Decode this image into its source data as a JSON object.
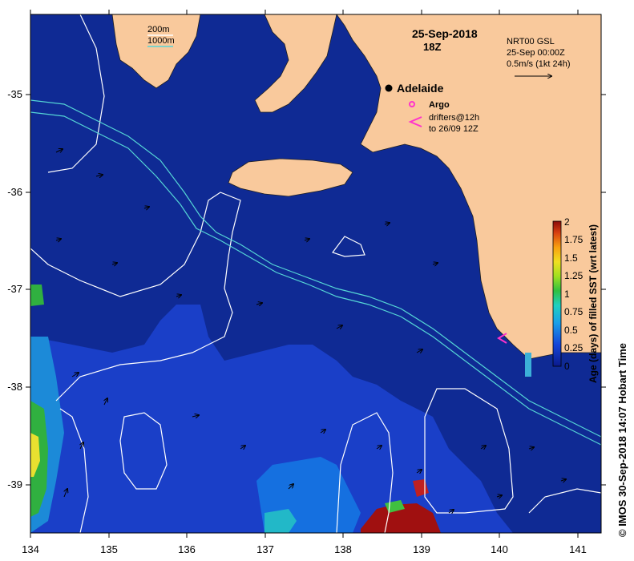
{
  "map": {
    "date_label": "25-Sep-2018",
    "time_label": "18Z",
    "lon_range": [
      134,
      141.3
    ],
    "lat_range": [
      -39.5,
      -34.2
    ],
    "lon_ticks": [
      "134",
      "135",
      "136",
      "137",
      "138",
      "139",
      "140",
      "141"
    ],
    "lat_ticks": [
      "-35",
      "-36",
      "-37",
      "-38",
      "-39"
    ],
    "colors": {
      "ocean": "#0f2a94",
      "land": "#f9c99c",
      "contour_200m": "#ffffff",
      "contour_1000m": "#55d6d6"
    }
  },
  "legend": {
    "isobath_200": "200m",
    "isobath_1000": "1000m",
    "city": "Adelaide",
    "argo": "Argo",
    "drifters_line1": "drifters@12h",
    "drifters_line2": "to 26/09 12Z",
    "current_source": "NRT00 GSL",
    "current_time": "25-Sep 00:00Z",
    "current_scale": "0.5m/s (1kt 24h)"
  },
  "colorbar": {
    "title": "Age (days) of filled SST (wrt latest)",
    "tick_labels": [
      "2",
      "1.75",
      "1.5",
      "1.25",
      "1",
      "0.75",
      "0.5",
      "0.25",
      "0"
    ],
    "range": [
      0,
      2
    ]
  },
  "credit": "© IMOS 30-Sep-2018 14:07 Hobart Time"
}
